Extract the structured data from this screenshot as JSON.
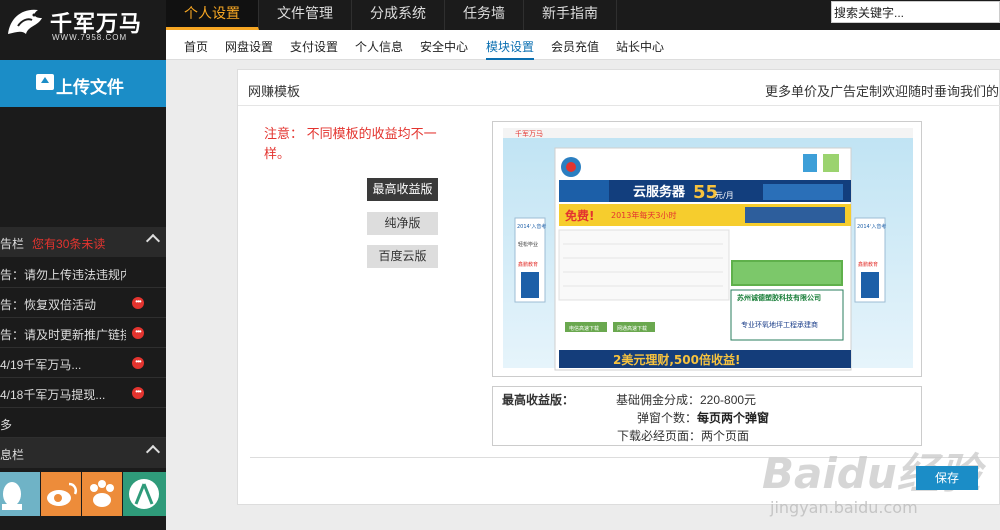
{
  "brand": {
    "name": "千军万马",
    "url": "WWW.7958.COM"
  },
  "main_nav": [
    "个人设置",
    "文件管理",
    "分成系统",
    "任务墙",
    "新手指南"
  ],
  "search": {
    "value": "搜索关键字..."
  },
  "sub_nav": [
    "首页",
    "网盘设置",
    "支付设置",
    "个人信息",
    "安全中心",
    "模块设置",
    "会员充值",
    "站长中心"
  ],
  "sidebar": {
    "upload_label": "上传文件",
    "notice_head": "告栏",
    "notice_unread": "您有30条未读",
    "notices": [
      "告：请勿上传违法违规内容",
      "告：恢复双倍活动",
      "告：请及时更新推广链接",
      "4/19千军万马...",
      "4/18千军万马提现...",
      "多"
    ],
    "unread_marker": "•••",
    "message_head": "息栏"
  },
  "panel": {
    "title": "网赚模板",
    "ad_text": "更多单价及广告定制欢迎随时垂询我们的",
    "notice": "注意： 不同模板的收益均不一样。",
    "versions": [
      "最高收益版",
      "纯净版",
      "百度云版"
    ]
  },
  "preview": {
    "site_name": "千军万马",
    "banner_cloud": "云服务器",
    "banner_price": "55",
    "banner_unit": "元/月",
    "free_text": "免费!",
    "promo_text": "2013年每天3小时",
    "side_ad_title": "2014ʻ入音考",
    "side_ad_line": "轻松毕业",
    "side_ad_brand": "鑫鹏教育",
    "company_ad": "苏州诚德塑胶科技有限公司",
    "company_ad2": "专业环氧地坪工程承建商",
    "finance_ad": "2美元理财,500倍收益!",
    "download_btn_1": "电信高速下载",
    "download_btn_2": "网通高速下载"
  },
  "info": {
    "label": "最高收益版：",
    "line1": "基础佣金分成：220-800元",
    "line2_prefix": "弹窗个数：",
    "line2_value": "每页两个弹窗",
    "line3": "下载必经页面：两个页面"
  },
  "save_label": "保存",
  "watermark": {
    "logo": "Baidu经验",
    "url": "jingyan.baidu.com"
  },
  "colors": {
    "accent": "#1b8dc7",
    "active_tab": "#f6a623",
    "notice_red": "#e3342f",
    "dark_bg": "#1b1b1b"
  }
}
